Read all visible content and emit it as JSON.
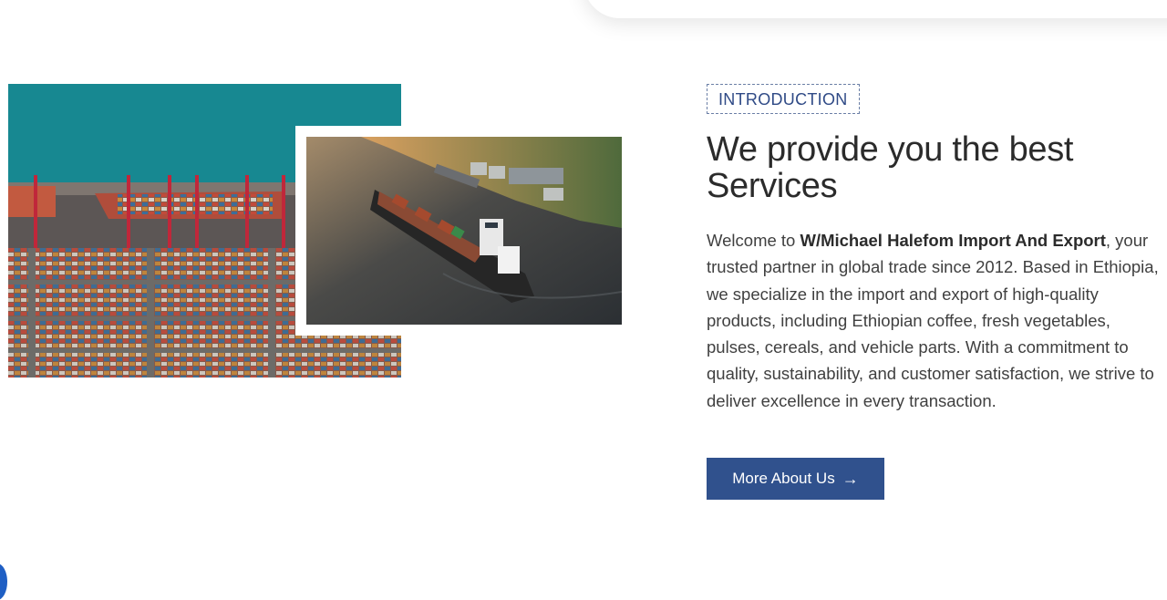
{
  "intro_section": {
    "badge": "INTRODUCTION",
    "headline": "We provide you the best Services",
    "paragraph": {
      "prefix": "Welcome to ",
      "company_name": "W/Michael Halefom Import And Export",
      "suffix": ", your trusted partner in global trade since 2012. Based in Ethiopia, we specialize in the import and export of high-quality products, including Ethiopian coffee, fresh vegetables, pulses, cereals, and vehicle parts. With a commitment to quality, sustainability, and customer satisfaction, we strive to deliver excellence in every transaction."
    },
    "cta_label": "More About Us",
    "cta_icon": "arrow-right-icon"
  },
  "colors": {
    "accent": "#30518d",
    "badge_text": "#2f4a86",
    "heading": "#2b2b2b",
    "body_text": "#404040"
  }
}
